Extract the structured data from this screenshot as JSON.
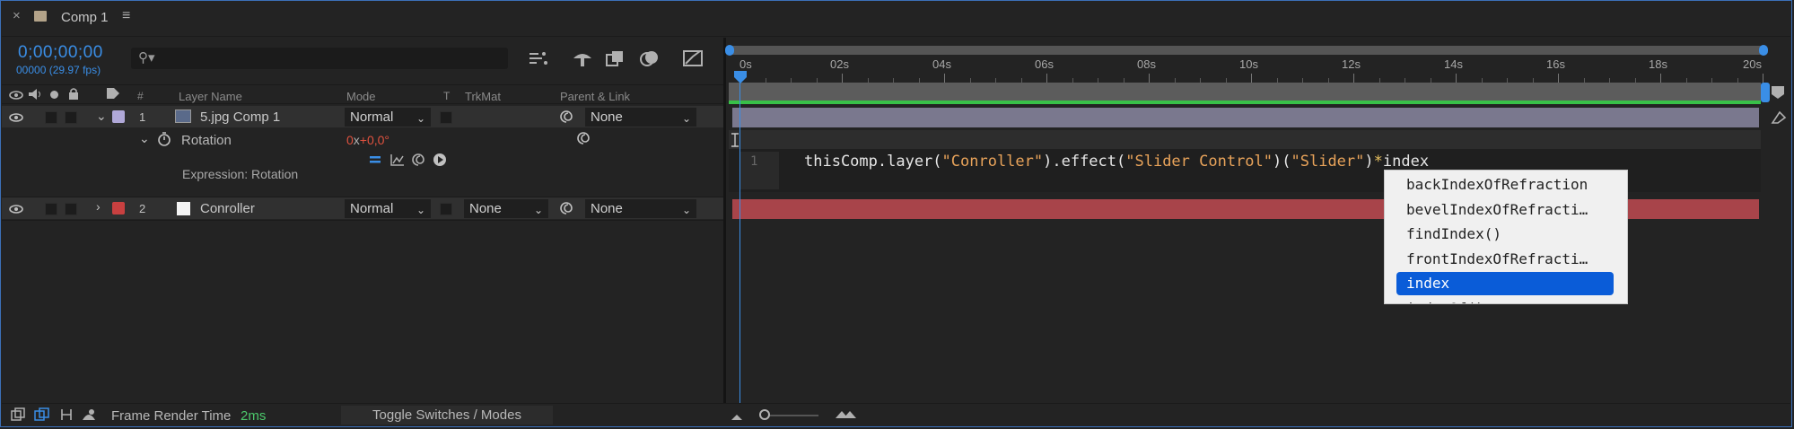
{
  "tab": {
    "close": "×",
    "title": "Comp 1",
    "menu": "≡"
  },
  "header": {
    "timecode": "0;00;00;00",
    "frame_info": "00000 (29.97 fps)",
    "search_placeholder": "",
    "columns": {
      "hash": "#",
      "layer_name": "Layer Name",
      "mode": "Mode",
      "t": "T",
      "trkmat": "TrkMat",
      "parent_link": "Parent & Link"
    }
  },
  "ruler": {
    "ticks": [
      "0s",
      "02s",
      "04s",
      "06s",
      "08s",
      "10s",
      "12s",
      "14s",
      "16s",
      "18s",
      "20s"
    ]
  },
  "layers": [
    {
      "number": "1",
      "name": "5.jpg Comp 1",
      "label_color": "#b0a8d8",
      "mode": "Normal",
      "parent": "None"
    },
    {
      "number": "2",
      "name": "Conroller",
      "label_color": "#c84040",
      "mode": "Normal",
      "trkmat": "None",
      "parent": "None"
    }
  ],
  "property": {
    "name": "Rotation",
    "value_x": "0",
    "value_sep": "x",
    "value_deg": "+0,0°",
    "expression_label": "Expression: Rotation"
  },
  "expression": {
    "line_number": "1",
    "code_prefix": "thisComp.layer(",
    "str1": "\"Conroller\"",
    "code_mid1": ").effect(",
    "str2": "\"Slider Control\"",
    "code_mid2": ")(",
    "str3": "\"Slider\"",
    "code_mid3": ")",
    "operator": "*",
    "code_suffix": "index"
  },
  "autocomplete": {
    "items": [
      "backIndexOfRefraction",
      "bevelIndexOfRefracti…",
      "findIndex()",
      "frontIndexOfRefracti…",
      "index",
      "indexOf()"
    ],
    "selected_index": 4
  },
  "footer": {
    "frame_render_label": "Frame Render Time",
    "frame_render_value": "2ms",
    "toggle_label": "Toggle Switches / Modes"
  },
  "colors": {
    "accent_blue": "#2f7fd8",
    "green_time": "#4cc86b",
    "layer_bar_purple": "#7a788e",
    "layer_bar_red": "#a8444a",
    "value_red": "#e0523f"
  }
}
